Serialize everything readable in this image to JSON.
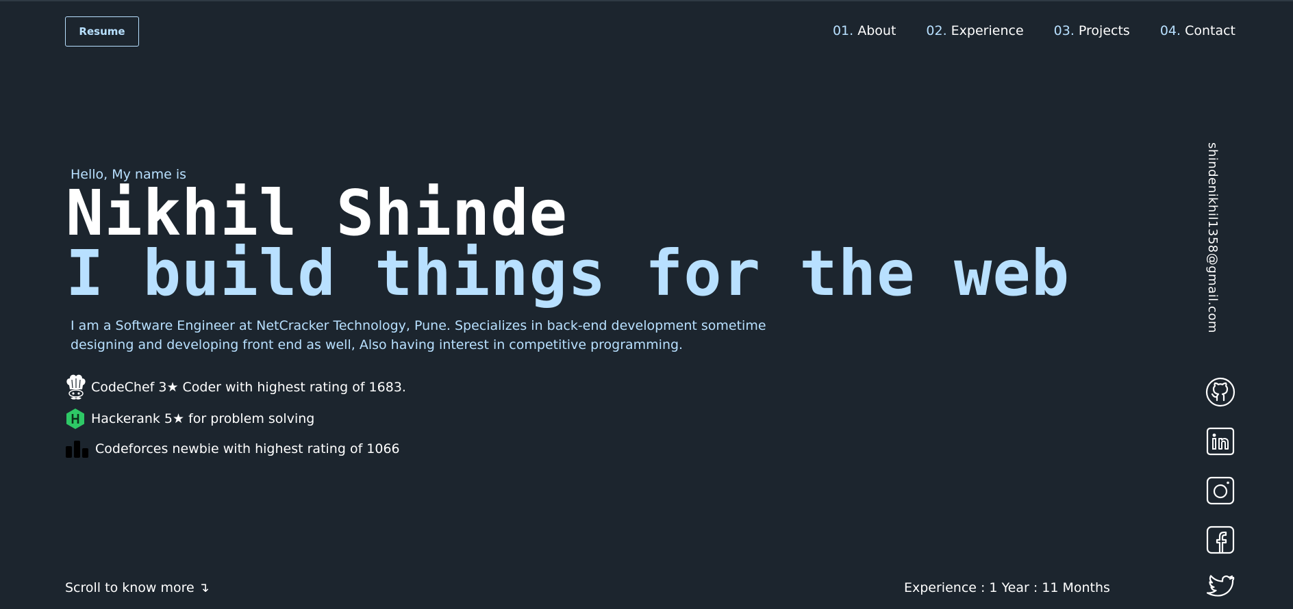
{
  "header": {
    "resume_label": "Resume",
    "nav": [
      {
        "num": "01.",
        "label": "About"
      },
      {
        "num": "02.",
        "label": "Experience"
      },
      {
        "num": "03.",
        "label": "Projects"
      },
      {
        "num": "04.",
        "label": "Contact"
      }
    ]
  },
  "hero": {
    "greeting": "Hello, My name is",
    "name": "Nikhil Shinde",
    "tagline": "I build things for the web",
    "bio": "I am a Software Engineer at NetCracker Technology, Pune. Specializes in back-end development sometime designing and developing front end as well, Also having interest in competitive programming."
  },
  "achievements": [
    {
      "icon": "codechef-chef-hat-icon",
      "text": "CodeChef 3★ Coder with highest rating of 1683."
    },
    {
      "icon": "hackerrank-icon",
      "text": "Hackerank 5★ for problem solving"
    },
    {
      "icon": "codeforces-icon",
      "text": "Codeforces newbie with highest rating of 1066"
    }
  ],
  "sidebar": {
    "email": "shindenikhil1358@gmail.com",
    "socials": [
      "github-icon",
      "linkedin-icon",
      "instagram-icon",
      "facebook-icon",
      "twitter-icon"
    ]
  },
  "footer": {
    "scroll_text": "Scroll to know more ↴",
    "experience_text": "Experience : 1 Year : 11 Months"
  },
  "colors": {
    "background": "#1c252e",
    "accent": "#b8e0ff",
    "text": "#ffffff",
    "hackerrank_green": "#2ec866"
  }
}
